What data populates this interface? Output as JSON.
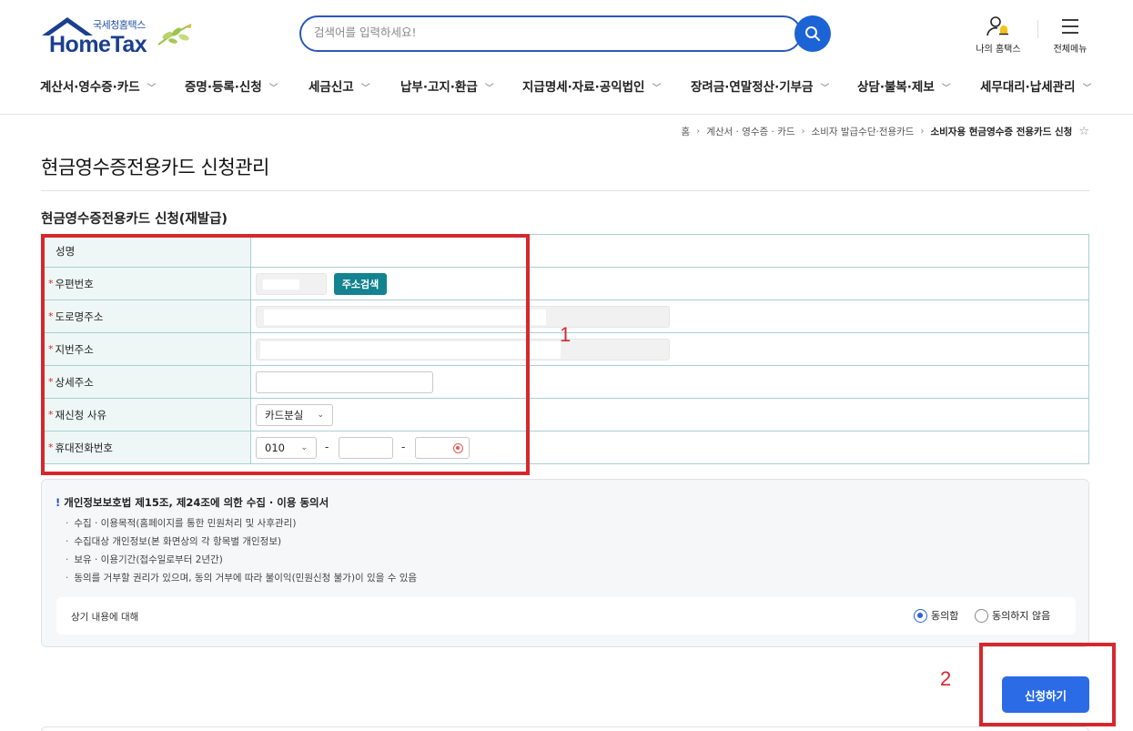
{
  "header": {
    "logo_sub": "국세청홈택스",
    "logo_main": "HomeTax",
    "search_placeholder": "검색어를 입력하세요!",
    "my_hometax": "나의 홈택스",
    "all_menu": "전체메뉴"
  },
  "gnb": [
    {
      "label": "계산서·영수증·카드"
    },
    {
      "label": "증명·등록·신청"
    },
    {
      "label": "세금신고"
    },
    {
      "label": "납부·고지·환급"
    },
    {
      "label": "지급명세·자료·공익법인"
    },
    {
      "label": "장려금·연말정산·기부금"
    },
    {
      "label": "상담·불복·제보"
    },
    {
      "label": "세무대리·납세관리"
    }
  ],
  "breadcrumb": {
    "home": "홈",
    "level1": "계산서 · 영수증 · 카드",
    "level2": "소비자 발급수단·전용카드",
    "current": "소비자용 현금영수증 전용카드 신청"
  },
  "page_title": "현금영수증전용카드 신청관리",
  "section_title": "현금영수증전용카드 신청(재발급)",
  "form": {
    "rows": [
      {
        "label": "성명",
        "required": false
      },
      {
        "label": "우편번호",
        "required": true
      },
      {
        "label": "도로명주소",
        "required": true
      },
      {
        "label": "지번주소",
        "required": true
      },
      {
        "label": "상세주소",
        "required": true
      },
      {
        "label": "재신청 사유",
        "required": true
      },
      {
        "label": "휴대전화번호",
        "required": true
      }
    ],
    "address_search_button": "주소검색",
    "reason_selected": "카드분실",
    "phone_prefix_selected": "010",
    "phone_dash": "-"
  },
  "consent": {
    "title": "개인정보보호법 제15조, 제24조에 의한 수집 · 이용 동의서",
    "items": [
      "수집 · 이용목적(홈페이지를 통한 민원처리 및 사후관리)",
      "수집대상 개인정보(본 화면상의 각 항목별 개인정보)",
      "보유 · 이용기간(접수일로부터 2년간)",
      "동의를 거부할 권리가 있으며, 동의 거부에 따라 불이익(민원신청 불가)이 있을 수 있음"
    ],
    "agree_prompt": "상기 내용에 대해",
    "agree": "동의함",
    "disagree": "동의하지 않음",
    "selected": "agree"
  },
  "submit_label": "신청하기",
  "annotations": {
    "box1_number": "1",
    "box2_number": "2",
    "color": "#d5282e"
  },
  "colors": {
    "brand_blue": "#1a3f8f",
    "search_button": "#1c63d5",
    "address_button": "#13838f",
    "submit_button": "#2b6be6",
    "label_bg": "#eef7f6",
    "table_border": "#a9cfd2"
  }
}
